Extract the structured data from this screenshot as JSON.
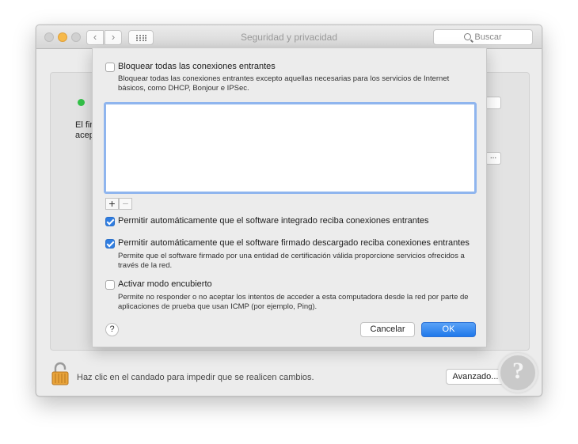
{
  "window": {
    "title": "Seguridad y privacidad",
    "search_placeholder": "Buscar",
    "nav_back": "‹",
    "nav_forward": "›"
  },
  "background_panel": {
    "peek_line1": "El fir",
    "peek_line2": "acep",
    "peek_button": "..."
  },
  "footer": {
    "lock_text": "Haz clic en el candado para impedir que se realicen cambios.",
    "advanced_button": "Avanzado..."
  },
  "sheet": {
    "block_all": {
      "label": "Bloquear todas las conexiones entrantes",
      "checked": false,
      "description": "Bloquear todas las conexiones entrantes excepto aquellas necesarias para los servicios de Internet básicos, como DHCP, Bonjour e IPSec."
    },
    "add_button": "+",
    "remove_button": "−",
    "allow_builtin": {
      "label": "Permitir automáticamente que el software integrado reciba conexiones entrantes",
      "checked": true
    },
    "allow_signed": {
      "label": "Permitir automáticamente que el software firmado descargado reciba conexiones entrantes",
      "checked": true,
      "description": "Permite que el software firmado por una entidad de certificación válida proporcione servicios ofrecidos a través de la red."
    },
    "stealth_mode": {
      "label": "Activar modo encubierto",
      "checked": false,
      "description": "Permite no responder o no aceptar los intentos de acceder a esta computadora desde la red por parte de aplicaciones de prueba que usan ICMP (por ejemplo, Ping)."
    },
    "help_button": "?",
    "cancel_button": "Cancelar",
    "ok_button": "OK"
  },
  "colors": {
    "accent": "#2f7de1",
    "status_green": "#33c148",
    "minimize_yellow": "#f6b94a"
  }
}
